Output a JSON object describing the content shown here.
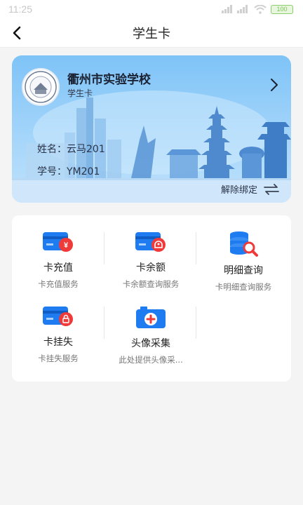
{
  "status_bar": {
    "time": "11:25",
    "battery": "100"
  },
  "navbar": {
    "title": "学生卡"
  },
  "card": {
    "school_name": "衢州市实验学校",
    "card_type": "学生卡",
    "name_line": "姓名：云马201",
    "id_line": "学号：YM201",
    "unbind_label": "解除绑定"
  },
  "services": [
    {
      "title": "卡充值",
      "desc": "卡充值服务",
      "icon": "card-yen-icon"
    },
    {
      "title": "卡余额",
      "desc": "卡余额查询服务",
      "icon": "card-wallet-icon"
    },
    {
      "title": "明细查询",
      "desc": "卡明细查询服务",
      "icon": "database-search-icon"
    },
    {
      "title": "卡挂失",
      "desc": "卡挂失服务",
      "icon": "card-lock-icon"
    },
    {
      "title": "头像采集",
      "desc": "此处提供头像采...",
      "icon": "camera-plus-icon"
    }
  ],
  "colors": {
    "accent_blue": "#1f7cf0",
    "accent_red": "#f03a3a",
    "card_sky": "#8fcbf8"
  }
}
